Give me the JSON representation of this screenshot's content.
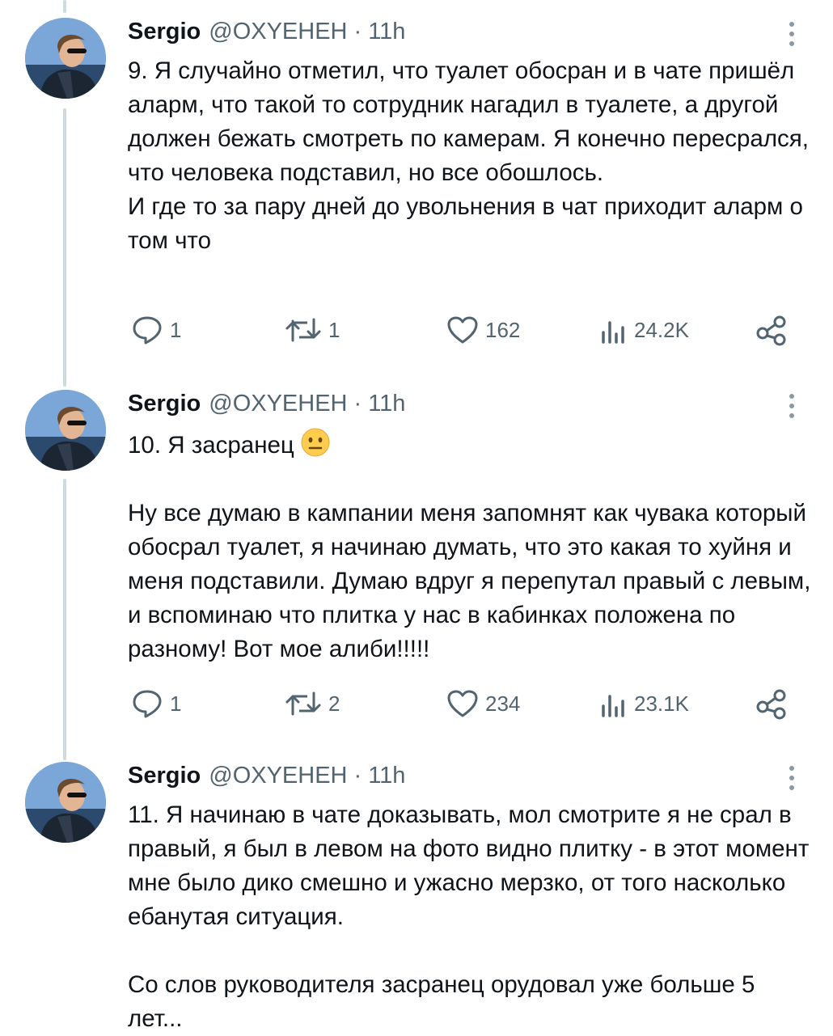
{
  "tweets": [
    {
      "name": "Sergio",
      "handle": "@OXYEHEH",
      "dot": "·",
      "time": "11h",
      "paragraphs": [
        "9. Я случайно отметил, что туалет обосран и в чате пришёл аларм, что такой то сотрудник нагадил в туалете, а другой должен бежать смотреть по камерам. Я конечно пересрался, что человека подставил, но все обошлось.",
        "И где то за пару дней до увольнения в чат приходит аларм о том что"
      ],
      "replies": "1",
      "reposts": "1",
      "likes": "162",
      "views": "24.2K"
    },
    {
      "name": "Sergio",
      "handle": "@OXYEHEH",
      "dot": "·",
      "time": "11h",
      "first_line": "10. Я засранец",
      "emoji": "neutral-face-emoji",
      "paragraphs": [
        "Ну все думаю в кампании меня запомнят как чувака который обосрал туалет, я начинаю думать, что это какая то хуйня и меня подставили. Думаю вдруг я перепутал правый с левым, и вспоминаю что плитка у нас в кабинках положена по разному! Вот мое алиби!!!!!"
      ],
      "replies": "1",
      "reposts": "2",
      "likes": "234",
      "views": "23.1K"
    },
    {
      "name": "Sergio",
      "handle": "@OXYEHEH",
      "dot": "·",
      "time": "11h",
      "paragraphs": [
        "11. Я начинаю в чате доказывать, мол смотрите я не срал в правый, я был в левом на фото видно плитку - в этот момент мне было дико смешно и ужасно мерзко, от того насколько ебанутая ситуация.",
        "Со слов руководителя засранец орудовал уже больше 5 лет..."
      ]
    }
  ],
  "icons": {
    "reply": "reply-icon",
    "repost": "repost-icon",
    "like": "heart-icon",
    "views": "views-icon",
    "share": "share-icon",
    "more": "more-icon"
  },
  "colors": {
    "text": "#0f1419",
    "muted": "#536471",
    "thread_line": "#cfd9de"
  }
}
